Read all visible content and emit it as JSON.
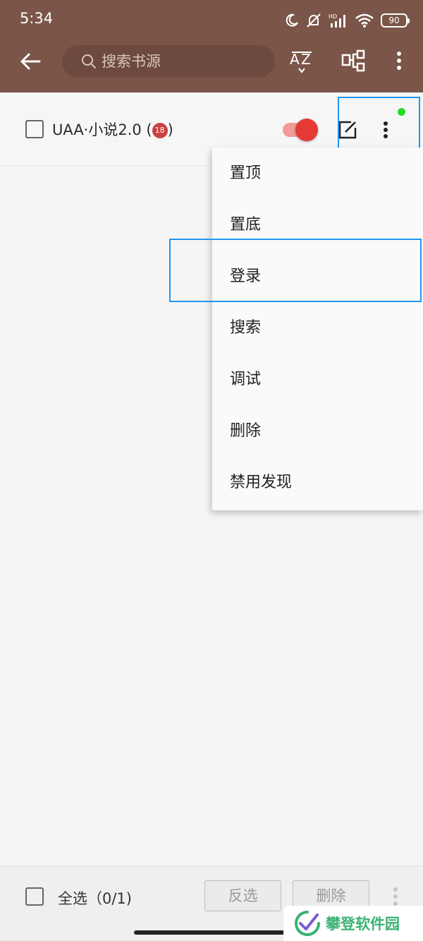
{
  "status_bar": {
    "time": "5:34",
    "battery": "90"
  },
  "toolbar": {
    "search_placeholder": "搜索书源"
  },
  "source": {
    "name": "UAA·小说2.0 (",
    "badge": "18",
    "name_suffix": ")",
    "enabled": true
  },
  "menu": {
    "items": [
      "置顶",
      "置底",
      "登录",
      "搜索",
      "调试",
      "删除",
      "禁用发现"
    ]
  },
  "bottom_bar": {
    "select_all_label": "全选（0/1)",
    "invert_button": "反选",
    "delete_button": "删除"
  },
  "watermark": {
    "text": "攀登软件园"
  },
  "colors": {
    "appbar": "#7a5548",
    "toggle_on": "#e53935",
    "highlight": "#2196f3",
    "dot": "#22dd22"
  }
}
